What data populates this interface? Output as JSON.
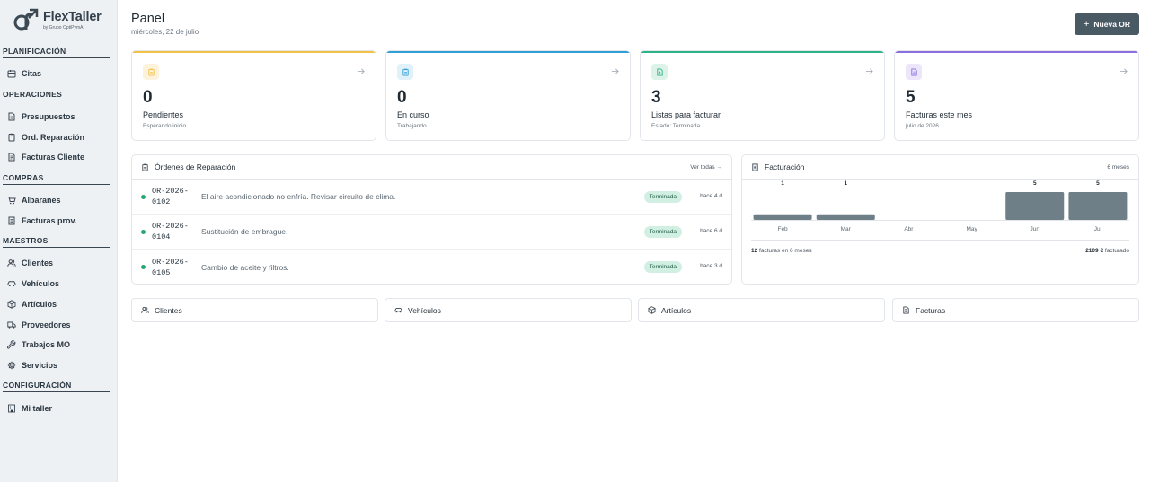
{
  "brand": {
    "name": "FlexTaller",
    "tagline": "by Grupo OptiPymA"
  },
  "sidebar": {
    "sections": [
      {
        "title": "PLANIFICACIÓN",
        "items": [
          {
            "label": "Citas",
            "icon": "calendar-icon"
          }
        ]
      },
      {
        "title": "OPERACIONES",
        "items": [
          {
            "label": "Presupuestos",
            "icon": "document-icon"
          },
          {
            "label": "Ord. Reparación",
            "icon": "clipboard-icon"
          },
          {
            "label": "Facturas Cliente",
            "icon": "invoice-icon"
          }
        ]
      },
      {
        "title": "COMPRAS",
        "items": [
          {
            "label": "Albaranes",
            "icon": "cart-icon"
          },
          {
            "label": "Facturas prov.",
            "icon": "receipt-icon"
          }
        ]
      },
      {
        "title": "MAESTROS",
        "items": [
          {
            "label": "Clientes",
            "icon": "users-icon"
          },
          {
            "label": "Vehículos",
            "icon": "car-icon"
          },
          {
            "label": "Artículos",
            "icon": "box-icon"
          },
          {
            "label": "Proveedores",
            "icon": "truck-icon"
          },
          {
            "label": "Trabajos MO",
            "icon": "wrench-icon"
          },
          {
            "label": "Servicios",
            "icon": "gear-icon"
          }
        ]
      },
      {
        "title": "CONFIGURACIÓN",
        "items": [
          {
            "label": "Mi taller",
            "icon": "building-icon"
          }
        ]
      }
    ]
  },
  "header": {
    "title": "Panel",
    "date": "miércoles, 22 de julio",
    "new_button": "Nueva OR"
  },
  "stats": [
    {
      "value": "0",
      "label": "Pendientes",
      "sub": "Esperando inicio",
      "color": "#f2c246",
      "bg": "#fdf3dc"
    },
    {
      "value": "0",
      "label": "En curso",
      "sub": "Trabajando",
      "color": "#2f9fd6",
      "bg": "#e1f1fa"
    },
    {
      "value": "3",
      "label": "Listas para facturar",
      "sub": "Estado: Terminada",
      "color": "#2db486",
      "bg": "#ddf3ea"
    },
    {
      "value": "5",
      "label": "Facturas este mes",
      "sub": "julio de 2026",
      "color": "#8b6ee0",
      "bg": "#ebe6fa"
    }
  ],
  "orders": {
    "title": "Órdenes de Reparación",
    "link": "Ver todas →",
    "rows": [
      {
        "code": "OR-2026-\n0102",
        "desc": "El aire acondicionado no enfría. Revisar circuito de clima.",
        "status": "Terminada",
        "ago": "hace 4 d"
      },
      {
        "code": "OR-2026-\n0104",
        "desc": "Sustitución de embrague.",
        "status": "Terminada",
        "ago": "hace 6 d"
      },
      {
        "code": "OR-2026-\n0105",
        "desc": "Cambio de aceite y filtros.",
        "status": "Terminada",
        "ago": "hace 3 d"
      }
    ]
  },
  "billing": {
    "title": "Facturación",
    "range": "6 meses",
    "footer_count": "12",
    "footer_count_text": "facturas en 6 meses",
    "footer_total": "2109 €",
    "footer_total_text": "facturado"
  },
  "chart_data": {
    "type": "bar",
    "categories": [
      "Feb",
      "Mar",
      "Abr",
      "May",
      "Jun",
      "Jul"
    ],
    "values": [
      1,
      1,
      0,
      0,
      5,
      5
    ],
    "ylim": [
      0,
      5
    ],
    "bar_color": "#6e7f88",
    "grid": false
  },
  "quick_links": [
    {
      "label": "Clientes",
      "icon": "users-icon"
    },
    {
      "label": "Vehículos",
      "icon": "car-icon"
    },
    {
      "label": "Artículos",
      "icon": "box-icon"
    },
    {
      "label": "Facturas",
      "icon": "invoice-icon"
    }
  ]
}
